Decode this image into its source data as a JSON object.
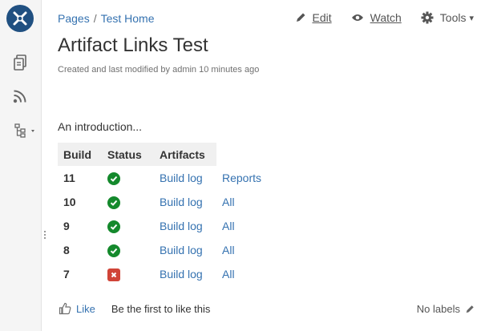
{
  "colors": {
    "link": "#3572b0",
    "success": "#14892c",
    "failure": "#d04437",
    "sidebar_bg": "#f5f5f5",
    "logo_bg": "#205081"
  },
  "sidebar": {
    "icons": [
      "confluence-logo-icon",
      "pages-icon",
      "rss-feed-icon",
      "page-tree-icon"
    ]
  },
  "breadcrumb": {
    "items": [
      "Pages",
      "Test Home"
    ],
    "separator": "/"
  },
  "actions": {
    "edit": "Edit",
    "watch": "Watch",
    "tools": "Tools",
    "tools_caret": "▾"
  },
  "page": {
    "title": "Artifact Links Test",
    "meta": "Created and last modified by admin 10 minutes ago",
    "intro": "An introduction..."
  },
  "table": {
    "headers": [
      "Build",
      "Status",
      "Artifacts"
    ],
    "rows": [
      {
        "build": "11",
        "status": "success",
        "artifacts": [
          "Build log",
          "Reports"
        ]
      },
      {
        "build": "10",
        "status": "success",
        "artifacts": [
          "Build log",
          "All"
        ]
      },
      {
        "build": "9",
        "status": "success",
        "artifacts": [
          "Build log",
          "All"
        ]
      },
      {
        "build": "8",
        "status": "success",
        "artifacts": [
          "Build log",
          "All"
        ]
      },
      {
        "build": "7",
        "status": "failure",
        "artifacts": [
          "Build log",
          "All"
        ]
      }
    ]
  },
  "footer": {
    "like_label": "Like",
    "like_text": "Be the first to like this",
    "labels_text": "No labels"
  }
}
